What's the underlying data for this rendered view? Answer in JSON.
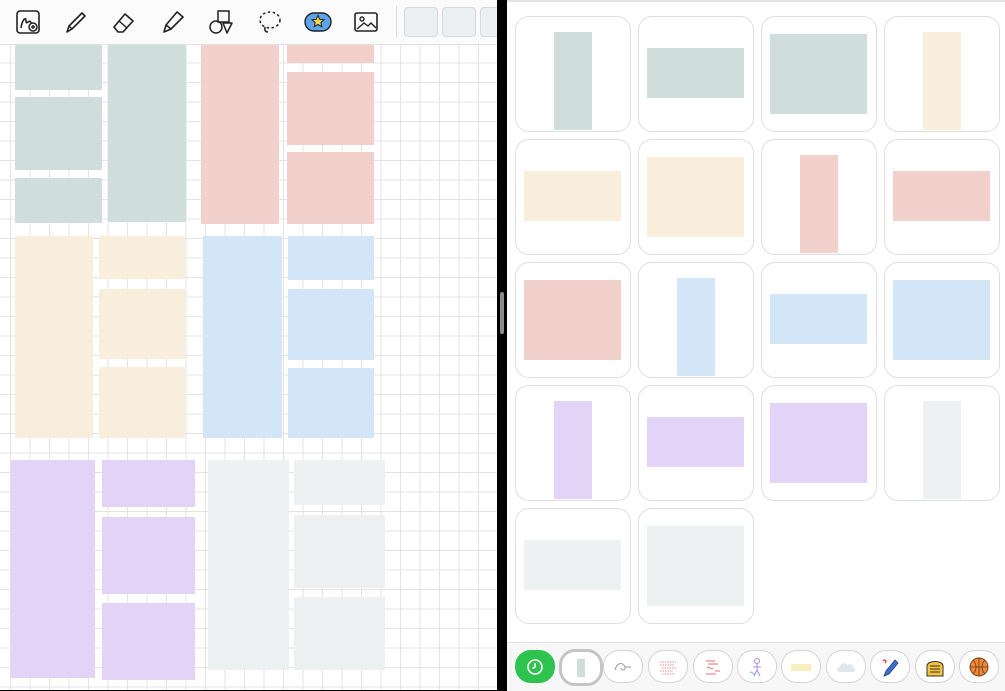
{
  "colors": {
    "green": "#cfdeda",
    "red": "#f2d1cd",
    "yellow": "#f9eedb",
    "blue": "#d2e6f8",
    "purple": "#e3d3f7",
    "gray": "#eef1f2",
    "recent_bg": "#2ec24e"
  },
  "toolbar": {
    "tools": [
      "lasso-draw-icon",
      "pen-icon",
      "eraser-icon",
      "highlighter-icon",
      "shapes-icon",
      "lasso-select-icon",
      "sticker-icon",
      "image-icon"
    ],
    "active_tool": "sticker-icon"
  },
  "canvas": {
    "notes": [
      {
        "color": "green"
      },
      {
        "color": "green"
      },
      {
        "color": "green"
      },
      {
        "color": "green"
      },
      {
        "color": "red"
      },
      {
        "color": "red"
      },
      {
        "color": "red"
      },
      {
        "color": "red"
      },
      {
        "color": "yellow"
      },
      {
        "color": "yellow"
      },
      {
        "color": "yellow"
      },
      {
        "color": "yellow"
      },
      {
        "color": "blue"
      },
      {
        "color": "blue"
      },
      {
        "color": "blue"
      },
      {
        "color": "blue"
      },
      {
        "color": "purple"
      },
      {
        "color": "purple"
      },
      {
        "color": "purple"
      },
      {
        "color": "purple"
      },
      {
        "color": "gray"
      },
      {
        "color": "gray"
      },
      {
        "color": "gray"
      },
      {
        "color": "gray"
      }
    ]
  },
  "library": {
    "stickers": [
      {
        "color": "green",
        "shape": "tall"
      },
      {
        "color": "green",
        "shape": "wide"
      },
      {
        "color": "green",
        "shape": "square"
      },
      {
        "color": "yellow",
        "shape": "tall"
      },
      {
        "color": "yellow",
        "shape": "wide"
      },
      {
        "color": "yellow",
        "shape": "square"
      },
      {
        "color": "red",
        "shape": "tall"
      },
      {
        "color": "red",
        "shape": "wide"
      },
      {
        "color": "red",
        "shape": "square"
      },
      {
        "color": "blue",
        "shape": "tall"
      },
      {
        "color": "blue",
        "shape": "wide"
      },
      {
        "color": "blue",
        "shape": "square"
      },
      {
        "color": "purple",
        "shape": "tall"
      },
      {
        "color": "purple",
        "shape": "wide"
      },
      {
        "color": "purple",
        "shape": "square"
      },
      {
        "color": "gray",
        "shape": "tall"
      },
      {
        "color": "gray",
        "shape": "wide"
      },
      {
        "color": "gray",
        "shape": "square"
      }
    ]
  },
  "sticker_categories": {
    "items": [
      "recent-clock-icon",
      "sticky-notes-category-icon",
      "line-doodle-category-icon",
      "red-notes-category-icon",
      "red-doodles-category-icon",
      "purple-figure-category-icon",
      "yellow-tape-category-icon",
      "cloud-category-icon",
      "pen-sticker-category-icon",
      "yellow-badge-category-icon",
      "basketball-category-icon"
    ],
    "selected": "sticky-notes-category-icon"
  }
}
